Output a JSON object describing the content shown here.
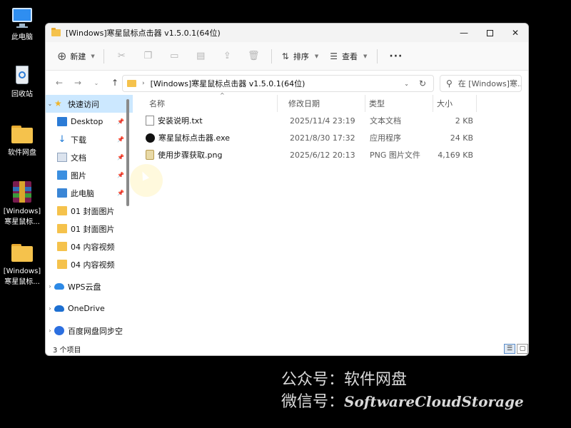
{
  "desktop": {
    "icons": [
      {
        "label": "此电脑"
      },
      {
        "label": "回收站"
      },
      {
        "label": "软件网盘"
      },
      {
        "label": "[Windows] 寒星鼠标..."
      },
      {
        "label": "[Windows] 寒星鼠标..."
      }
    ]
  },
  "window": {
    "title": "[Windows]寒星鼠标点击器 v1.5.0.1(64位)",
    "controls": {
      "minimize": "—",
      "close": "✕"
    }
  },
  "toolbar": {
    "new_label": "新建",
    "sort_label": "排序",
    "view_label": "查看",
    "more_label": "···"
  },
  "address": {
    "path": "[Windows]寒星鼠标点击器 v1.5.0.1(64位)",
    "search_placeholder": "在 [Windows]寒..."
  },
  "sidebar": {
    "items": [
      {
        "label": "快速访问",
        "icon": "star-icon"
      },
      {
        "label": "Desktop",
        "icon": "desktop-icon"
      },
      {
        "label": "下载",
        "icon": "download-icon"
      },
      {
        "label": "文档",
        "icon": "document-icon"
      },
      {
        "label": "图片",
        "icon": "pictures-icon"
      },
      {
        "label": "此电脑",
        "icon": "computer-icon"
      },
      {
        "label": "01 封面图片",
        "icon": "folder-icon"
      },
      {
        "label": "01 封面图片",
        "icon": "folder-icon"
      },
      {
        "label": "04 内容视频",
        "icon": "folder-icon"
      },
      {
        "label": "04 内容视频",
        "icon": "folder-icon"
      },
      {
        "label": "WPS云盘",
        "icon": "cloud-icon"
      },
      {
        "label": "OneDrive",
        "icon": "onedrive-icon"
      },
      {
        "label": "百度网盘同步空",
        "icon": "baidu-icon"
      }
    ]
  },
  "list": {
    "columns": {
      "name": "名称",
      "date": "修改日期",
      "type": "类型",
      "size": "大小"
    },
    "rows": [
      {
        "name": "安装说明.txt",
        "date": "2025/11/4 23:19",
        "type": "文本文档",
        "size": "2 KB"
      },
      {
        "name": "寒星鼠标点击器.exe",
        "date": "2021/8/30 17:32",
        "type": "应用程序",
        "size": "24 KB"
      },
      {
        "name": "使用步骤获取.png",
        "date": "2025/6/12 20:13",
        "type": "PNG 图片文件",
        "size": "4,169 KB"
      }
    ]
  },
  "status": {
    "count": "3 个项目"
  },
  "watermark": {
    "line1": "公众号：软件网盘",
    "line2_prefix": "微信号：",
    "line2_en": "SoftwareCloudStorage"
  }
}
